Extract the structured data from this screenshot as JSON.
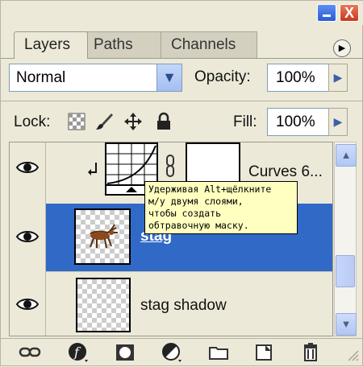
{
  "tabs": [
    {
      "label": "Layers",
      "active": true
    },
    {
      "label": "Paths",
      "active": false
    },
    {
      "label": "Channels",
      "active": false
    }
  ],
  "window": {
    "close_glyph": "X",
    "menu_glyph": "▶"
  },
  "blend_mode": {
    "value": "Normal",
    "dropdown_glyph": "▼"
  },
  "opacity": {
    "label": "Opacity:",
    "value": "100%",
    "arrow": "▶"
  },
  "lock": {
    "label": "Lock:"
  },
  "fill": {
    "label": "Fill:",
    "value": "100%",
    "arrow": "▶"
  },
  "layers": [
    {
      "name": "Curves 6...",
      "type": "adjustment",
      "visible": true,
      "selected": false
    },
    {
      "name": "stag",
      "type": "pixel",
      "visible": true,
      "selected": true
    },
    {
      "name": "stag shadow",
      "type": "pixel",
      "visible": true,
      "selected": false
    }
  ],
  "tooltip": {
    "lines": [
      "Удерживая Alt+щёлкните",
      "м/у двумя слоями,",
      "чтобы создать",
      "обтравочную маску."
    ]
  },
  "scrollbar": {
    "up": "▲",
    "down": "▼"
  },
  "colors": {
    "selection": "#3169c6",
    "panel_bg": "#ece9d8",
    "tooltip_bg": "#ffffc0"
  },
  "bottom_toolbar": [
    "link-icon",
    "layer-style-icon",
    "mask-icon",
    "adjustment-icon",
    "folder-icon",
    "new-layer-icon",
    "trash-icon"
  ]
}
